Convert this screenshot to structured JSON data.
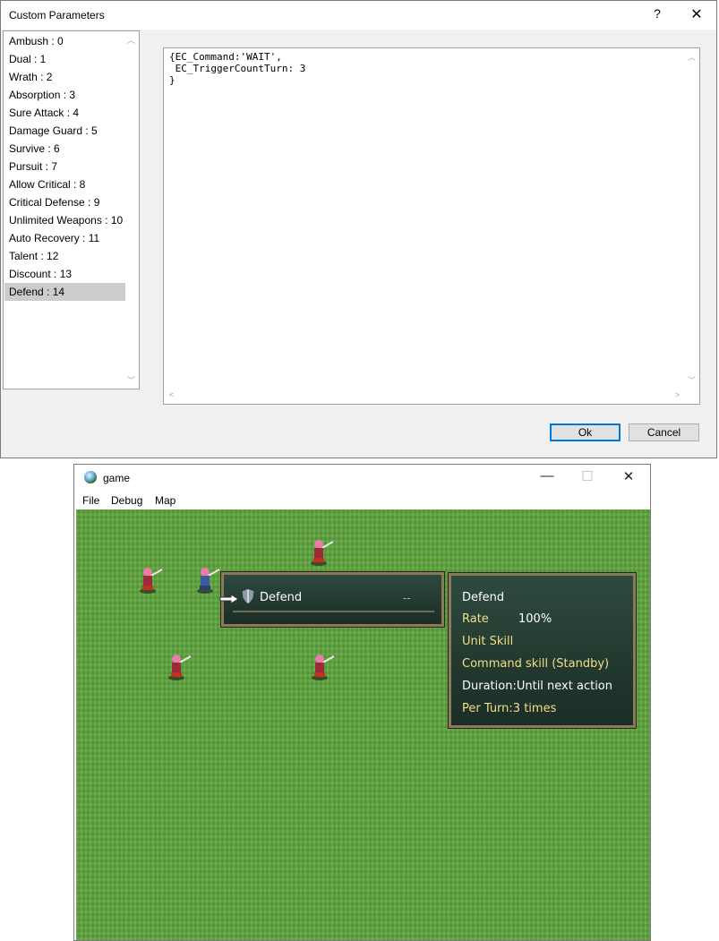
{
  "dialog": {
    "title": "Custom Parameters",
    "help_label": "?",
    "close_label": "✕",
    "params": [
      "Ambush : 0",
      "Dual : 1",
      "Wrath : 2",
      "Absorption : 3",
      "Sure Attack : 4",
      "Damage Guard : 5",
      "Survive : 6",
      "Pursuit : 7",
      "Allow Critical : 8",
      "Critical Defense : 9",
      "Unlimited Weapons : 10",
      "Auto Recovery : 11",
      "Talent : 12",
      "Discount : 13",
      "Defend : 14"
    ],
    "selected_index": 14,
    "editor_text": "{EC_Command:'WAIT',\n EC_TriggerCountTurn: 3\n}",
    "ok_label": "Ok",
    "cancel_label": "Cancel"
  },
  "game": {
    "title": "game",
    "menu": [
      "File",
      "Debug",
      "Map"
    ],
    "command": {
      "label": "Defend",
      "value": "--"
    },
    "info": {
      "name": "Defend",
      "rate_label": "Rate",
      "rate_value": "100%",
      "type": "Unit Skill",
      "kind": "Command skill (Standby)",
      "duration": "Duration:Until next action",
      "per_turn": "Per Turn:3 times"
    }
  },
  "colors": {
    "grass": "#5fa63e",
    "panel_bg": "#1b2d26",
    "panel_border": "#8a7a5a",
    "highlight_text": "#f2df86",
    "selection": "#cccccc"
  }
}
